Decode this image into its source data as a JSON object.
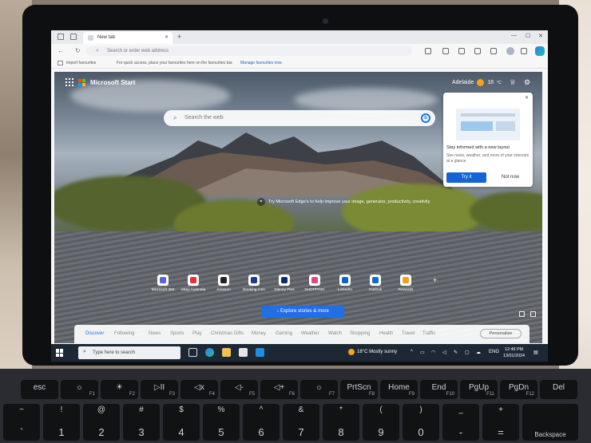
{
  "browser": {
    "tab_title": "New tab",
    "address_placeholder": "Search or enter web address",
    "favbar": {
      "import": "Import favourites",
      "quick_text": "For quick access, place your favourites here on the favourites bar.",
      "manage_link": "Manage favourites now"
    }
  },
  "page": {
    "brand": "Microsoft Start",
    "weather": {
      "city": "Adelaide",
      "temp": "18",
      "unit": "°C"
    },
    "search_placeholder": "Search the web",
    "caption": "Try Microsoft Edge's to help improve your image, generator, productivity, creativity",
    "popup": {
      "title": "Stay informed with a new layout",
      "body": "See news, weather, and more of your interests at a glance",
      "primary": "Try it",
      "secondary": "Not now"
    },
    "quick_links": [
      {
        "label": "Microsoft 365",
        "color": "#5a64d8"
      },
      {
        "label": "eBay Australia",
        "color": "#e53238"
      },
      {
        "label": "Amazon",
        "color": "#222222"
      },
      {
        "label": "Booking.com",
        "color": "#1a3a8a"
      },
      {
        "label": "Disney Plus",
        "color": "#0d2a6b"
      },
      {
        "label": "SHOPPING",
        "color": "#e04a7a"
      },
      {
        "label": "LinkedIn",
        "color": "#0a66c2"
      },
      {
        "label": "Outlook",
        "color": "#0f6cbd"
      },
      {
        "label": "Rewards",
        "color": "#f2a01a"
      }
    ],
    "explore_button": "Explore stories & more",
    "feed_tabs": [
      "Discover",
      "Following",
      "News",
      "Sports",
      "Play",
      "Christmas Gifts",
      "Money",
      "Gaming",
      "Weather",
      "Watch",
      "Shopping",
      "Health",
      "Travel",
      "Traffic"
    ],
    "personalize": "Personalize"
  },
  "taskbar": {
    "search_placeholder": "Type here to search",
    "weather": "18°C  Mostly sunny",
    "lang": "ENG",
    "time": "12:46 PM",
    "date": "13/01/2024"
  },
  "keyboard": {
    "fn_row": [
      {
        "main": "esc",
        "sub": ""
      },
      {
        "main": "☼",
        "sub": "F1"
      },
      {
        "main": "☀",
        "sub": "F2"
      },
      {
        "main": "▷II",
        "sub": "F3"
      },
      {
        "main": "◁x",
        "sub": "F4"
      },
      {
        "main": "◁-",
        "sub": "F5"
      },
      {
        "main": "◁+",
        "sub": "F6"
      },
      {
        "main": "☼",
        "sub": "F7"
      },
      {
        "main": "PrtScn",
        "sub": "F8"
      },
      {
        "main": "Home",
        "sub": "F9"
      },
      {
        "main": "End",
        "sub": "F10"
      },
      {
        "main": "PgUp",
        "sub": "F11"
      },
      {
        "main": "PgDn",
        "sub": "F12"
      },
      {
        "main": "Del",
        "sub": ""
      }
    ],
    "num_row": [
      {
        "top": "~",
        "main": "`"
      },
      {
        "top": "!",
        "main": "1"
      },
      {
        "top": "@",
        "main": "2"
      },
      {
        "top": "#",
        "main": "3"
      },
      {
        "top": "$",
        "main": "4"
      },
      {
        "top": "%",
        "main": "5"
      },
      {
        "top": "^",
        "main": "6"
      },
      {
        "top": "&",
        "main": "7"
      },
      {
        "top": "*",
        "main": "8"
      },
      {
        "top": "(",
        "main": "9"
      },
      {
        "top": ")",
        "main": "0"
      },
      {
        "top": "_",
        "main": "-"
      },
      {
        "top": "+",
        "main": "="
      },
      {
        "top": "",
        "main": "Backspace"
      }
    ]
  }
}
